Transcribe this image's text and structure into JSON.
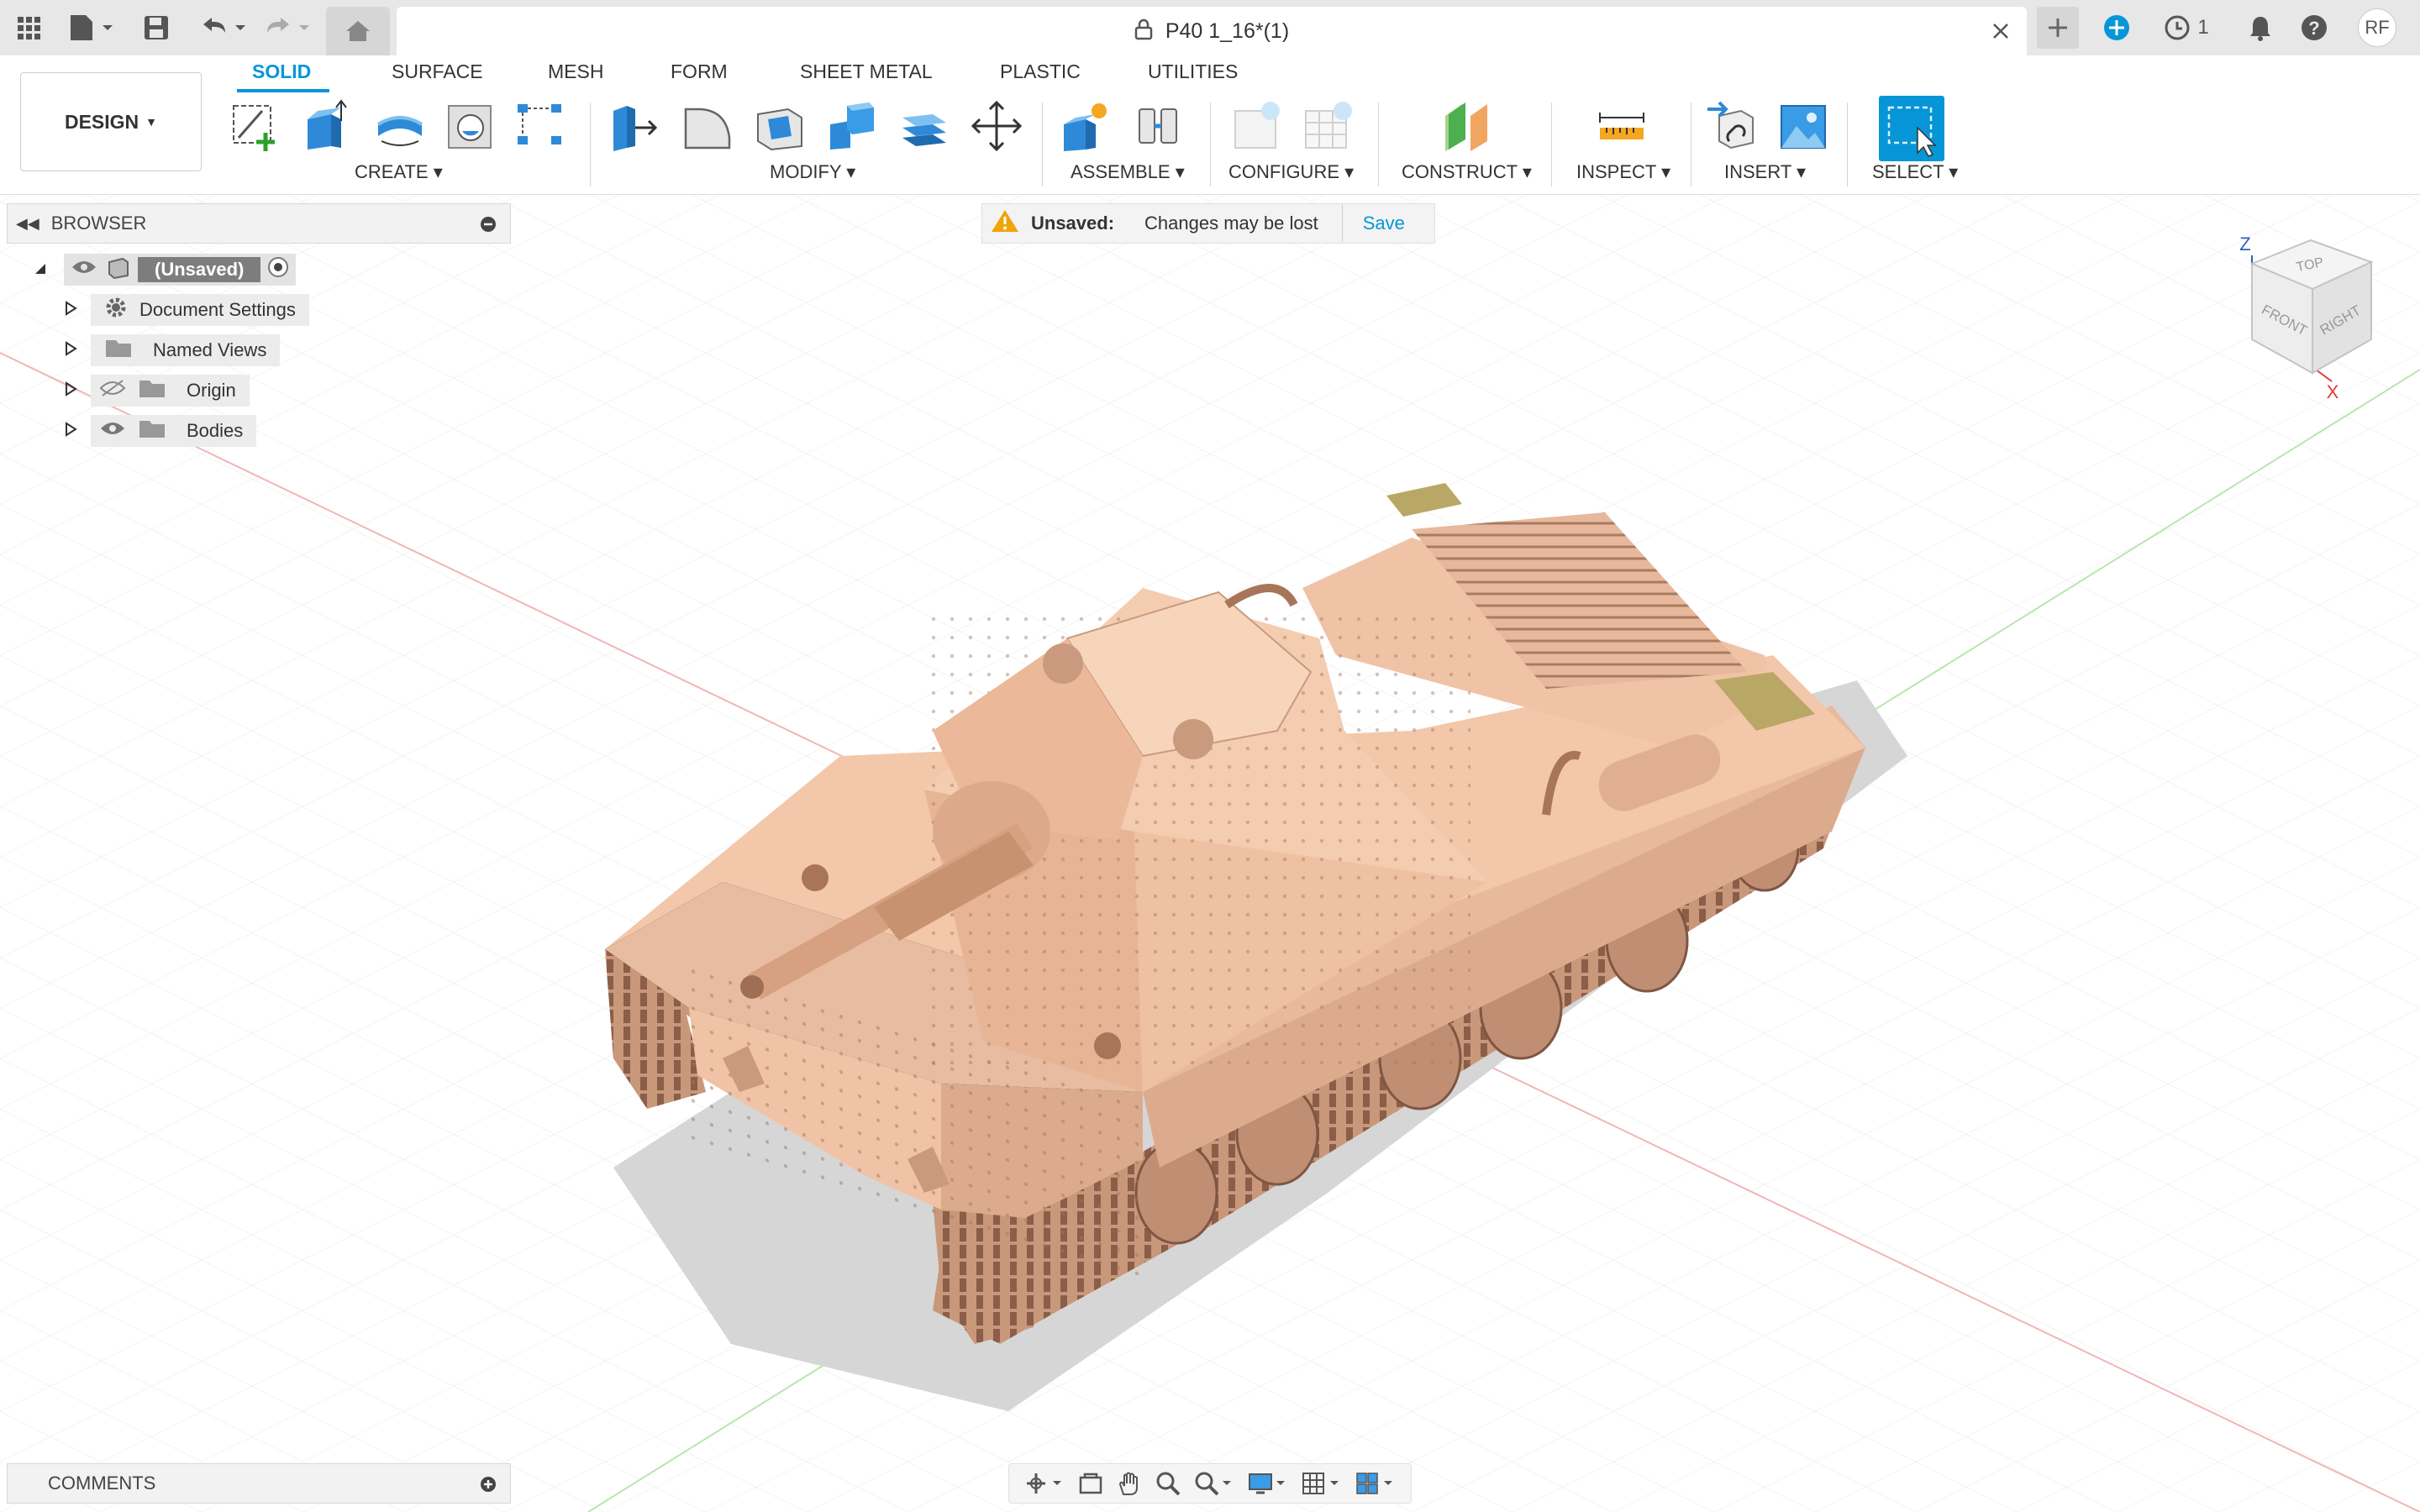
{
  "app": {
    "document_title": "P40 1_16*(1)",
    "job_count": "1",
    "user_initials": "RF"
  },
  "ribbon": {
    "workspace_button": "DESIGN",
    "tabs": [
      {
        "label": "SOLID",
        "active": true
      },
      {
        "label": "SURFACE"
      },
      {
        "label": "MESH"
      },
      {
        "label": "FORM"
      },
      {
        "label": "SHEET METAL"
      },
      {
        "label": "PLASTIC"
      },
      {
        "label": "UTILITIES"
      }
    ],
    "groups": {
      "create": "CREATE",
      "modify": "MODIFY",
      "assemble": "ASSEMBLE",
      "configure": "CONFIGURE",
      "construct": "CONSTRUCT",
      "inspect": "INSPECT",
      "insert": "INSERT",
      "select": "SELECT"
    }
  },
  "browser": {
    "header": "BROWSER",
    "root": "(Unsaved)",
    "items": [
      "Document Settings",
      "Named Views",
      "Origin",
      "Bodies"
    ]
  },
  "unsaved_bar": {
    "label": "Unsaved:",
    "message": "Changes may be lost",
    "action": "Save"
  },
  "comments": {
    "label": "COMMENTS"
  },
  "viewcube": {
    "top": "TOP",
    "front": "FRONT",
    "right": "RIGHT",
    "axis_z": "Z",
    "axis_x": "X"
  },
  "colors": {
    "accent": "#0696d7",
    "model": "#f0c6a8",
    "warning": "#f0a30a"
  }
}
